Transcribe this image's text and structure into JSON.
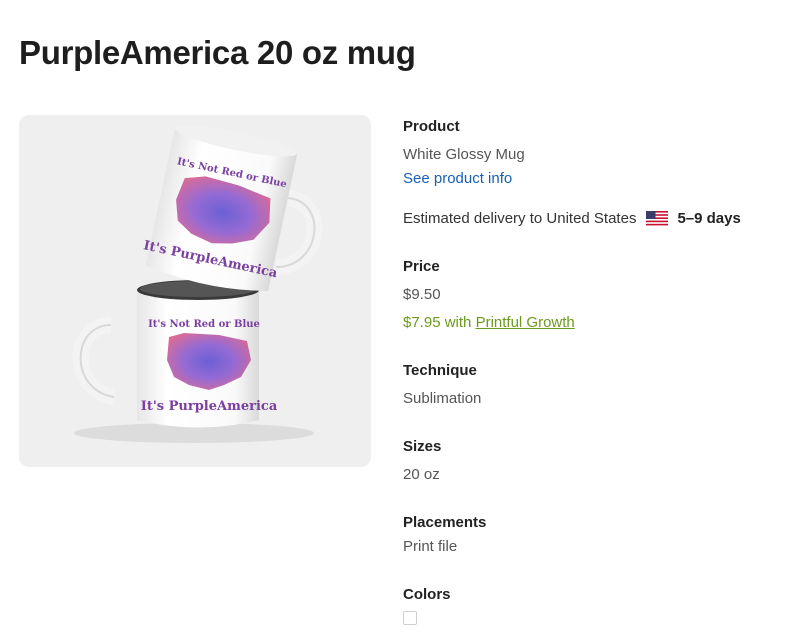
{
  "title": "PurpleAmerica 20 oz mug",
  "image": {
    "mug_top_line1": "It's Not Red or Blue",
    "mug_top_line2": "It's PurpleAmerica",
    "mug_bottom_line1": "It's Not Red or Blue",
    "mug_bottom_line2": "It's PurpleAmerica",
    "colors": {
      "purple_text": "#7a3fa0",
      "map_blue": "#4a4fc9",
      "map_red": "#d0456a",
      "background": "#efefef"
    }
  },
  "product": {
    "label": "Product",
    "value": "White Glossy Mug",
    "info_link": "See product info"
  },
  "delivery": {
    "text": "Estimated delivery to United States",
    "flag_icon": "us-flag-icon",
    "days": "5–9 days"
  },
  "price": {
    "label": "Price",
    "value": "$9.50",
    "growth_price": "$7.95 with",
    "growth_link": "Printful Growth",
    "growth_color": "#6b9a1f"
  },
  "technique": {
    "label": "Technique",
    "value": "Sublimation"
  },
  "sizes": {
    "label": "Sizes",
    "value": "20 oz"
  },
  "placements": {
    "label": "Placements",
    "value": "Print file"
  },
  "colors": {
    "label": "Colors",
    "swatches": [
      "#ffffff"
    ]
  }
}
